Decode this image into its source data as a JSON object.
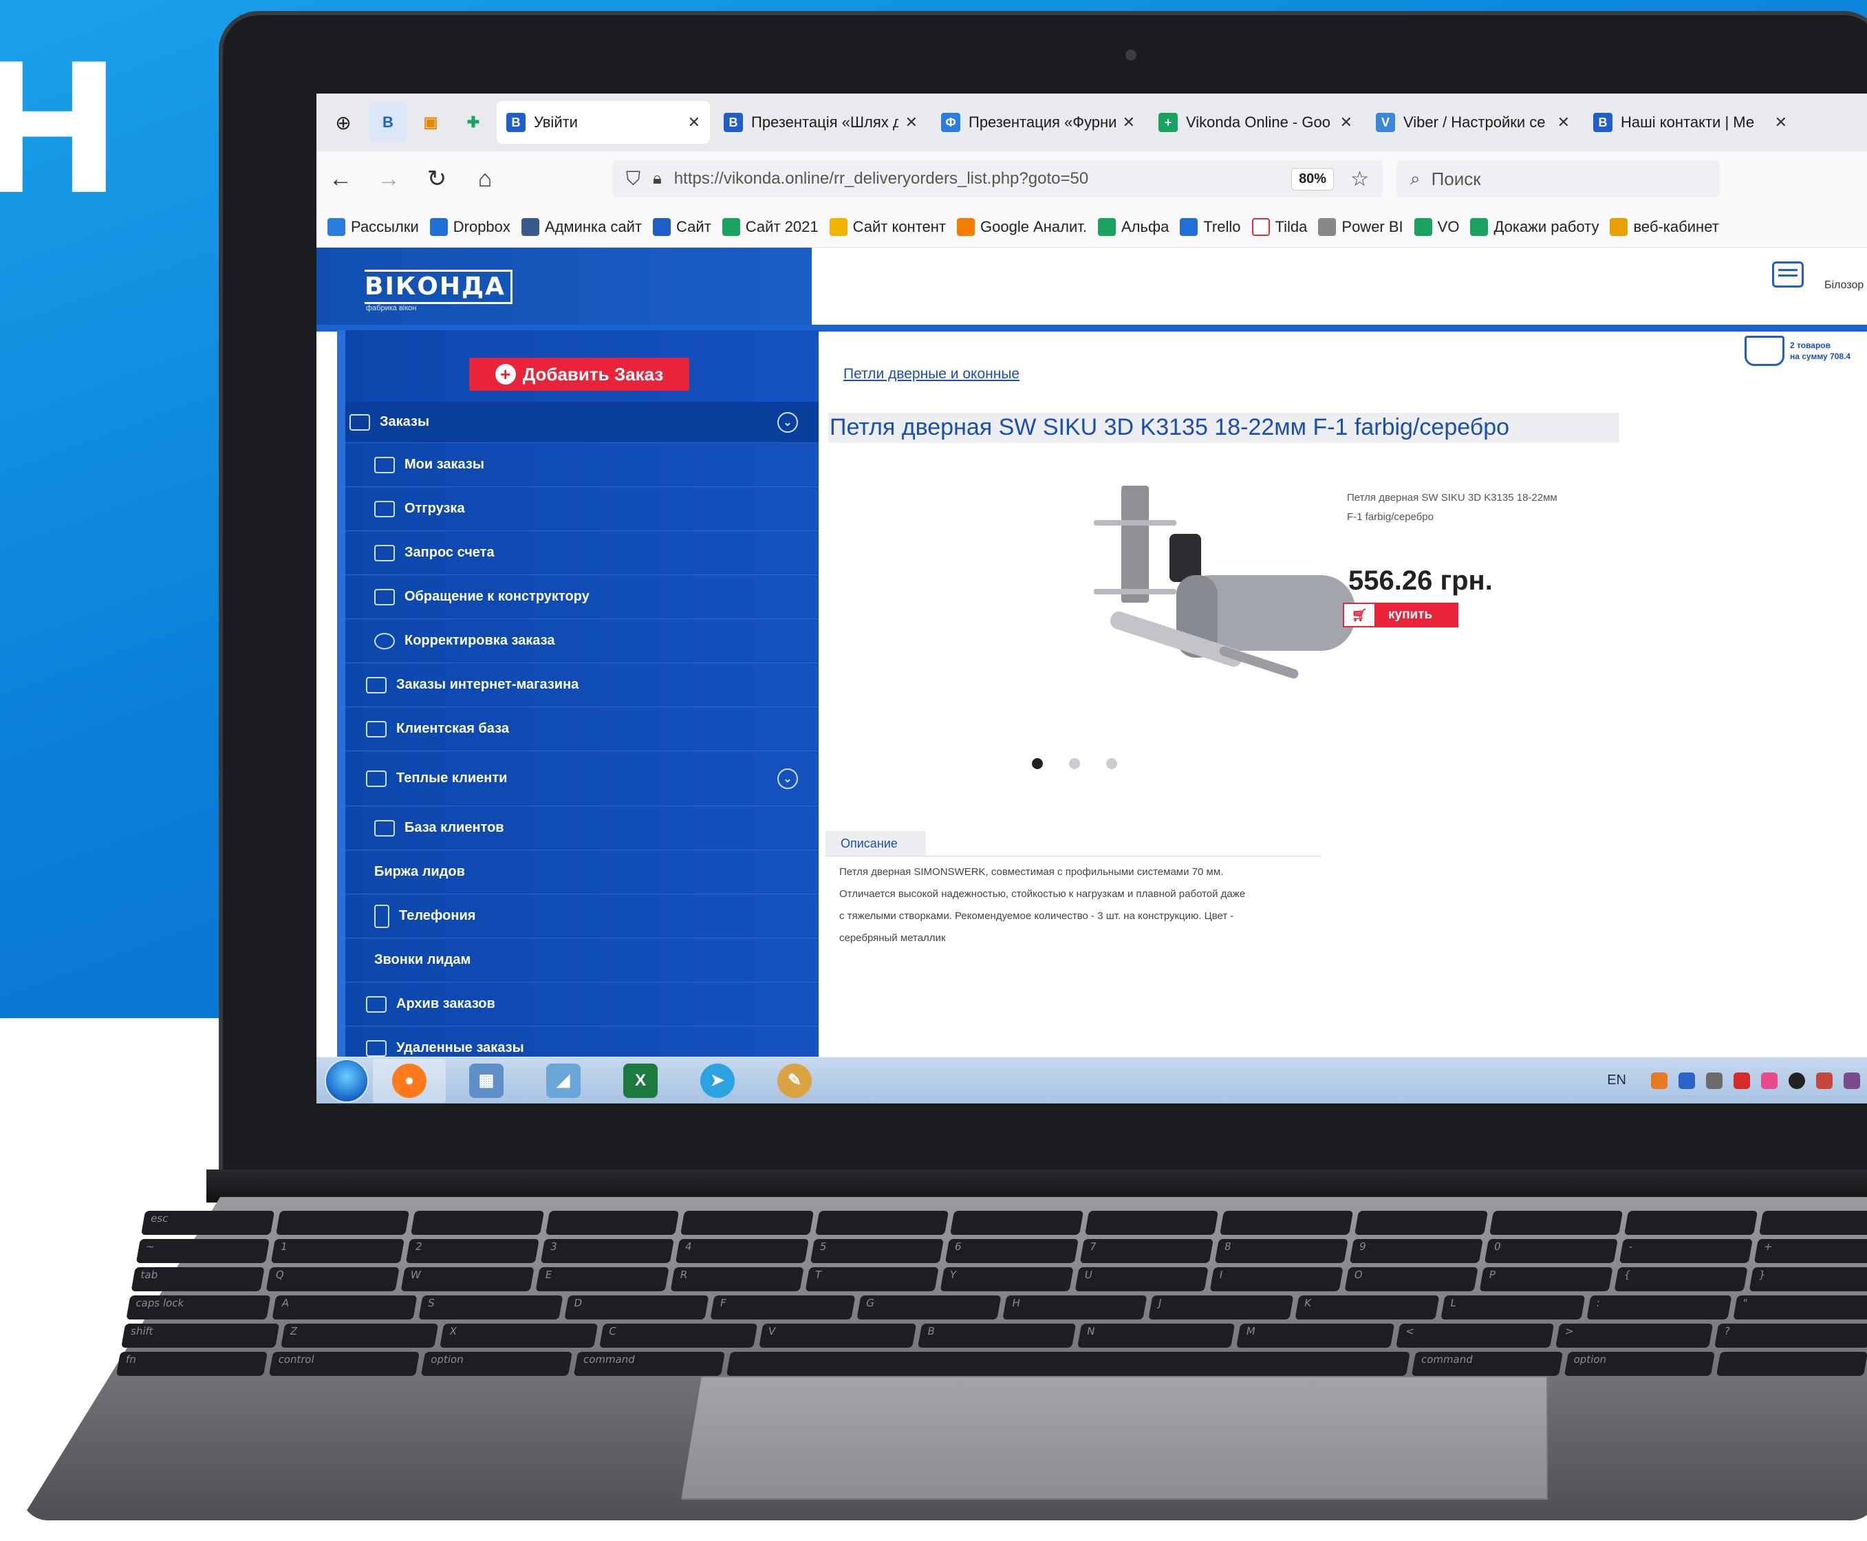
{
  "brand": {
    "letter": "Н"
  },
  "browser": {
    "tabs": [
      {
        "label": "Увійти",
        "fav_color": "#1f5fc9",
        "fav_glyph": "B"
      },
      {
        "label": "Презентація «Шлях до",
        "fav_color": "#1f5fc9",
        "fav_glyph": "B"
      },
      {
        "label": "Презентация «Фурни",
        "fav_color": "#2b7de0",
        "fav_glyph": "Ф"
      },
      {
        "label": "Vikonda Online - Goo",
        "fav_color": "#1aa260",
        "fav_glyph": "+"
      },
      {
        "label": "Viber / Настройки се",
        "fav_color": "#3b86d8",
        "fav_glyph": "V"
      },
      {
        "label": "Наші контакти | Ме",
        "fav_color": "#1f5fc9",
        "fav_glyph": "B"
      }
    ],
    "url": "https://vikonda.online/rr_deliveryorders_list.php?goto=50",
    "zoom": "80%",
    "search_placeholder": "Поиск",
    "bookmarks": [
      {
        "label": "Рассылки",
        "color": "#2b7de0"
      },
      {
        "label": "Dropbox",
        "color": "#1f6fd6"
      },
      {
        "label": "Админка сайт",
        "color": "#3a5a8c"
      },
      {
        "label": "Сайт",
        "color": "#1f5fc9"
      },
      {
        "label": "Сайт 2021",
        "color": "#1aa260"
      },
      {
        "label": "Сайт контент",
        "color": "#f2b400"
      },
      {
        "label": "Google Аналит.",
        "color": "#f57c00"
      },
      {
        "label": "Альфа",
        "color": "#1aa260"
      },
      {
        "label": "Trello",
        "color": "#1f6fd6"
      },
      {
        "label": "Tilda",
        "color": "#ffffff"
      },
      {
        "label": "Power BI",
        "color": "#888888"
      },
      {
        "label": "VO",
        "color": "#1aa260"
      },
      {
        "label": "Докажи работу",
        "color": "#1aa260"
      },
      {
        "label": "веб-кабинет",
        "color": "#e8a000"
      }
    ]
  },
  "site": {
    "logo": "ВІКОНДА",
    "logo_sub": "фабрика вікон",
    "header_city": "Білозор",
    "cart": {
      "line1": "2 товаров",
      "line2": "на сумму 708.4"
    },
    "add_order": "Добавить Заказ",
    "menu": [
      {
        "label": "Заказы",
        "level": 0,
        "chevron": true
      },
      {
        "label": "Мои заказы",
        "level": 1
      },
      {
        "label": "Отгрузка",
        "level": 1
      },
      {
        "label": "Запрос счета",
        "level": 1
      },
      {
        "label": "Обращение к конструктору",
        "level": 1
      },
      {
        "label": "Корректировка заказа",
        "level": 1
      },
      {
        "label": "Заказы интернет-магазина",
        "level": 0
      },
      {
        "label": "Клиентская база",
        "level": 0
      },
      {
        "label": "Теплые клиенти",
        "level": 0,
        "chevron": true
      },
      {
        "label": "База клиентов",
        "level": 1
      },
      {
        "label": "Биржа лидов",
        "level": 1
      },
      {
        "label": "Телефония",
        "level": 1
      },
      {
        "label": "Звонки лидам",
        "level": 1
      },
      {
        "label": "Архив заказов",
        "level": 0
      },
      {
        "label": "Удаленные заказы",
        "level": 0
      }
    ],
    "breadcrumb": "Петли дверные и оконные",
    "product_title": "Петля дверная SW SIKU 3D K3135 18-22мм F-1 farbig/серебро",
    "product_short": "Петля дверная SW SIKU 3D K3135 18-22мм F-1 farbig/серебро",
    "price": "556.26 грн.",
    "buy_label": "купить",
    "description_tab": "Описание",
    "description": [
      "Петля дверная SIMONSWERK, совместимая с профильными системами 70 мм.",
      "Отличается высокой надежностью, стойкостью к нагрузкам и плавной работой даже",
      "с тяжелыми створками. Рекомендуемое количество - 3 шт. на конструкцию. Цвет -",
      "серебряный металлик"
    ],
    "carousel_total": 3,
    "carousel_active": 1
  },
  "taskbar": {
    "lang": "EN",
    "apps": [
      {
        "name": "firefox",
        "color": "#ff7a1a",
        "glyph": "●"
      },
      {
        "name": "calculator",
        "color": "#5e8fc7",
        "glyph": "▦"
      },
      {
        "name": "notes",
        "color": "#6aa6d8",
        "glyph": "◢"
      },
      {
        "name": "excel",
        "color": "#1d7a3f",
        "glyph": "X"
      },
      {
        "name": "telegram",
        "color": "#2aa3e0",
        "glyph": "➤"
      },
      {
        "name": "paint",
        "color": "#d9a441",
        "glyph": "✎"
      }
    ]
  }
}
